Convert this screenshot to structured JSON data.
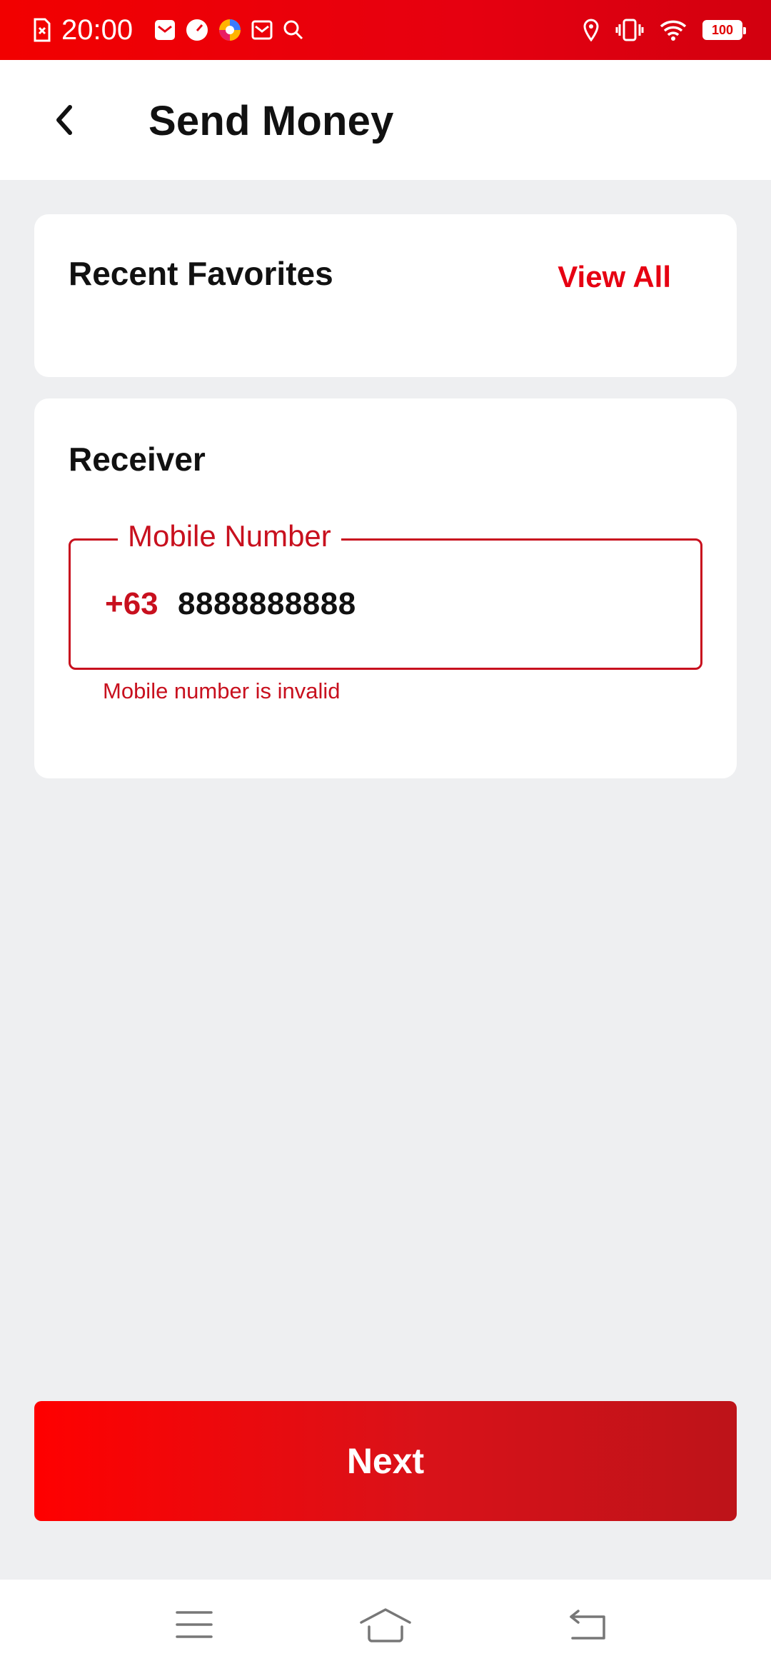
{
  "status_bar": {
    "time": "20:00",
    "battery": "100",
    "icons": [
      "sim-icon",
      "mail-icon",
      "gauge-icon",
      "browser-icon",
      "inbox-icon",
      "search-icon",
      "location-icon",
      "vibrate-icon",
      "wifi-icon",
      "battery-icon"
    ]
  },
  "app_bar": {
    "title": "Send Money",
    "back_icon": "chevron-left-icon"
  },
  "favorites": {
    "title": "Recent Favorites",
    "view_all_label": "View All"
  },
  "receiver": {
    "title": "Receiver",
    "field_label": "Mobile Number",
    "country_code": "+63",
    "value": "8888888888",
    "error": "Mobile number is invalid"
  },
  "actions": {
    "next_label": "Next"
  },
  "nav_bar": {
    "icons": [
      "menu-icon",
      "home-icon",
      "back-icon"
    ]
  },
  "colors": {
    "accent": "#e60012",
    "error": "#c8101e",
    "background": "#eeeff1"
  }
}
